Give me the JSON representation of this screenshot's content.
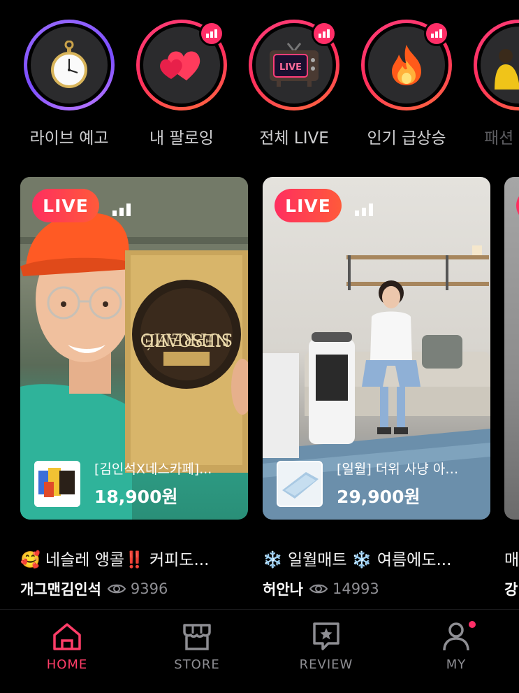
{
  "stories": [
    {
      "label": "라이브 예고",
      "icon": "pocket-watch-icon",
      "ring": "purple",
      "badge": false
    },
    {
      "label": "내 팔로잉",
      "icon": "hearts-icon",
      "ring": "pink",
      "badge": true
    },
    {
      "label": "전체 LIVE",
      "icon": "live-tv-icon",
      "ring": "pink",
      "badge": true,
      "tv_text": "LIVE"
    },
    {
      "label": "인기 급상승",
      "icon": "fire-icon",
      "ring": "pink",
      "badge": true
    },
    {
      "label": "패션",
      "icon": "person-icon",
      "ring": "pink",
      "badge": false
    }
  ],
  "cards": [
    {
      "live_label": "LIVE",
      "product_name": "[김인석X네스카페]...",
      "price": "18,900원",
      "title": "🥰 네슬레 앵콜‼️ 커피도...",
      "host": "개그맨김인석",
      "views": "9396"
    },
    {
      "live_label": "LIVE",
      "product_name": "[일월] 더위 사냥 아…",
      "price": "29,900원",
      "title": "❄️ 일월매트 ❄️ 여름에도...",
      "host": "허안나",
      "views": "14993"
    },
    {
      "title": "매",
      "host": "강"
    }
  ],
  "nav": {
    "home": "HOME",
    "store": "STORE",
    "review": "REVIEW",
    "my": "MY"
  },
  "colors": {
    "accent": "#ff2e67",
    "live_gradient_start": "#ff2e5f",
    "live_gradient_end": "#ff5a3a",
    "muted": "#8e8e93"
  }
}
